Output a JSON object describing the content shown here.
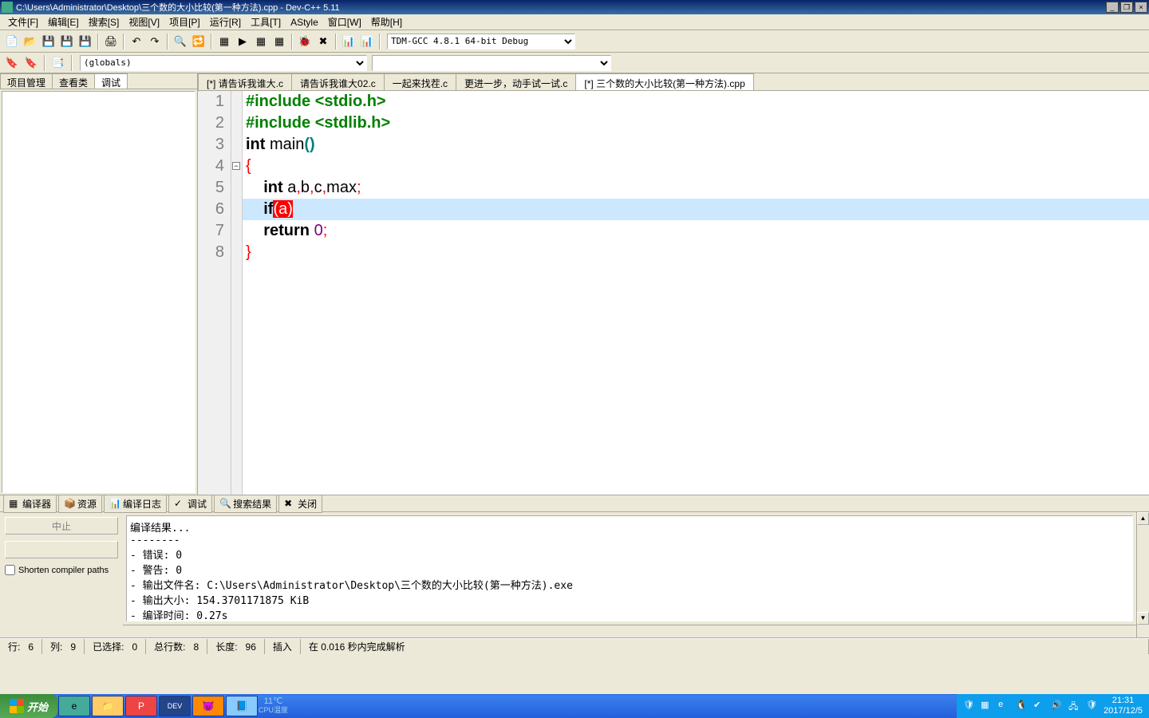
{
  "title": "C:\\Users\\Administrator\\Desktop\\三个数的大小比较(第一种方法).cpp - Dev-C++ 5.11",
  "menus": [
    "文件[F]",
    "编辑[E]",
    "搜索[S]",
    "视图[V]",
    "项目[P]",
    "运行[R]",
    "工具[T]",
    "AStyle",
    "窗口[W]",
    "帮助[H]"
  ],
  "compiler": "TDM-GCC 4.8.1 64-bit Debug",
  "globals": "(globals)",
  "left_tabs": [
    "项目管理",
    "查看类",
    "调试"
  ],
  "left_active": 2,
  "file_tabs": [
    "[*] 请告诉我谁大.c",
    "请告诉我谁大02.c",
    "一起来找茬.c",
    "更进一步，动手试一试.c",
    "[*] 三个数的大小比较(第一种方法).cpp"
  ],
  "file_active": 4,
  "code": {
    "lines": [
      {
        "n": 1,
        "seg": [
          {
            "t": "#include ",
            "c": "pp"
          },
          {
            "t": "<stdio.h>",
            "c": "pp"
          }
        ]
      },
      {
        "n": 2,
        "seg": [
          {
            "t": "#include ",
            "c": "pp"
          },
          {
            "t": "<stdlib.h>",
            "c": "pp"
          }
        ]
      },
      {
        "n": 3,
        "seg": [
          {
            "t": "int",
            "c": "kw"
          },
          {
            "t": " main",
            "c": ""
          },
          {
            "t": "()",
            "c": "paren"
          }
        ]
      },
      {
        "n": 4,
        "seg": [
          {
            "t": "{",
            "c": "punct"
          }
        ],
        "fold": true
      },
      {
        "n": 5,
        "seg": [
          {
            "t": "    ",
            "c": ""
          },
          {
            "t": "int",
            "c": "kw"
          },
          {
            "t": " a",
            "c": ""
          },
          {
            "t": ",",
            "c": "punct"
          },
          {
            "t": "b",
            "c": ""
          },
          {
            "t": ",",
            "c": "punct"
          },
          {
            "t": "c",
            "c": ""
          },
          {
            "t": ",",
            "c": "punct"
          },
          {
            "t": "max",
            "c": ""
          },
          {
            "t": ";",
            "c": "punct"
          }
        ]
      },
      {
        "n": 6,
        "hl": true,
        "seg": [
          {
            "t": "    ",
            "c": ""
          },
          {
            "t": "if",
            "c": "kw"
          },
          {
            "t": "(",
            "c": "bracket-match"
          },
          {
            "t": "a",
            "c": "sel"
          },
          {
            "t": ")",
            "c": "bracket-match"
          }
        ]
      },
      {
        "n": 7,
        "seg": [
          {
            "t": "    ",
            "c": ""
          },
          {
            "t": "return",
            "c": "kw"
          },
          {
            "t": " ",
            "c": ""
          },
          {
            "t": "0",
            "c": "num"
          },
          {
            "t": ";",
            "c": "punct"
          }
        ]
      },
      {
        "n": 8,
        "seg": [
          {
            "t": "}",
            "c": "punct"
          }
        ]
      }
    ]
  },
  "bottom_tabs": [
    "编译器",
    "资源",
    "编译日志",
    "调试",
    "搜索结果",
    "关闭"
  ],
  "abort_btn": "中止",
  "shorten_label": "Shorten compiler paths",
  "compile_output": "编译结果...\n--------\n- 错误: 0\n- 警告: 0\n- 输出文件名: C:\\Users\\Administrator\\Desktop\\三个数的大小比较(第一种方法).exe\n- 输出大小: 154.3701171875 KiB\n- 编译时间: 0.27s",
  "status": {
    "line_lbl": "行:",
    "line": "6",
    "col_lbl": "列:",
    "col": "9",
    "sel_lbl": "已选择:",
    "sel": "0",
    "tot_lbl": "总行数:",
    "tot": "8",
    "len_lbl": "长度:",
    "len": "96",
    "ins": "插入",
    "parse": "在 0.016 秒内完成解析"
  },
  "start_label": "开始",
  "temp": "11℃",
  "temp_sub": "CPU温度",
  "time": "21:31",
  "date": "2017/12/5"
}
